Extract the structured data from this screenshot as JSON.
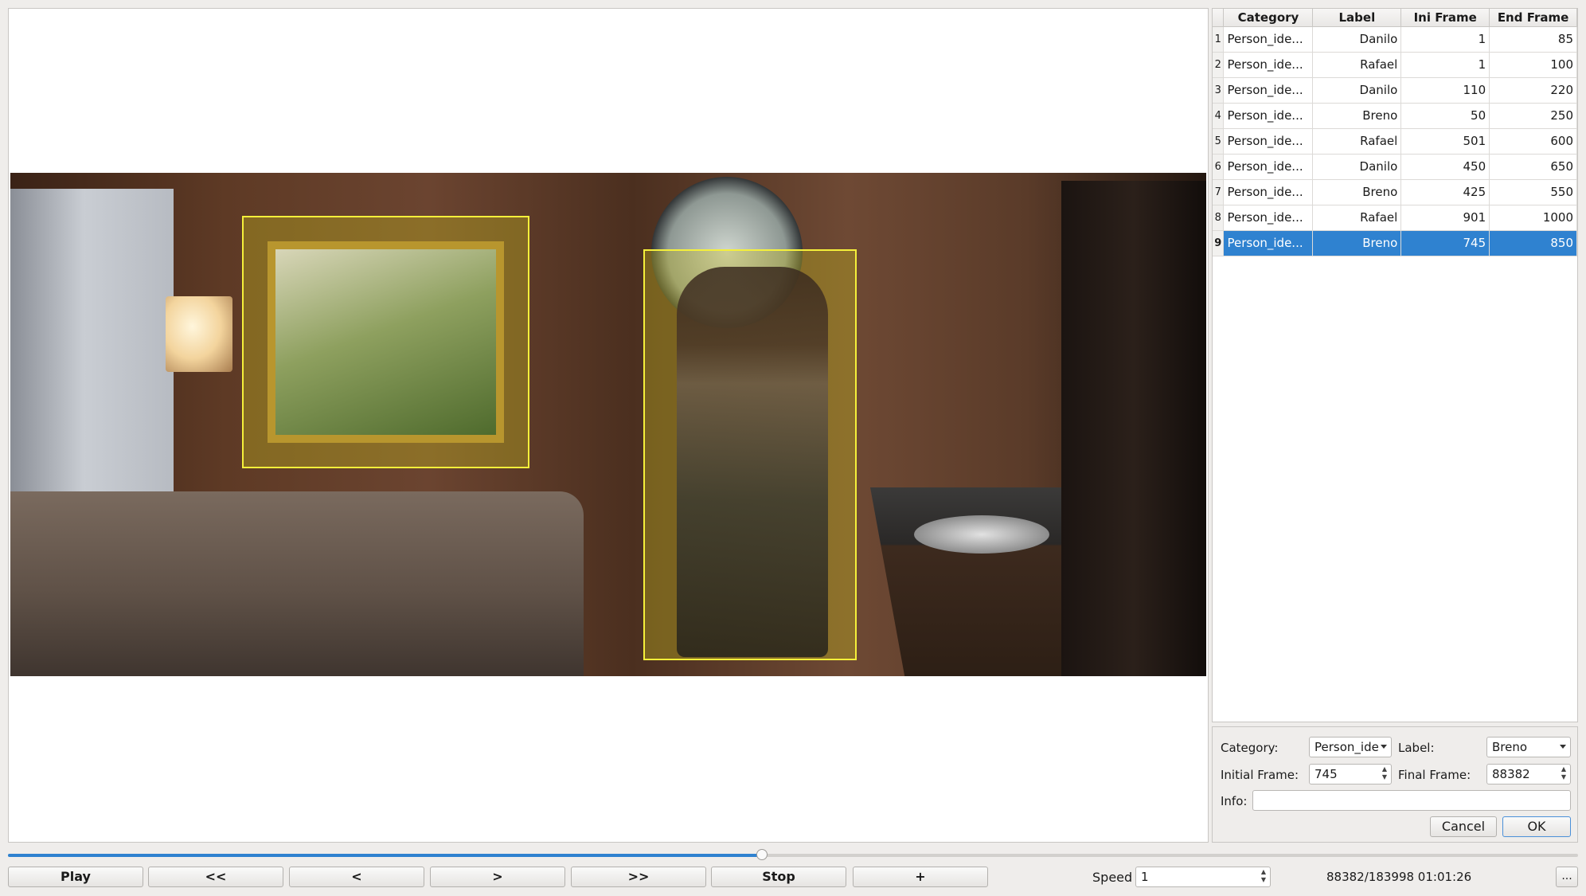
{
  "table": {
    "headers": [
      "Category",
      "Label",
      "Ini Frame",
      "End Frame"
    ],
    "rows": [
      {
        "index": "1",
        "category": "Person_ide...",
        "label": "Danilo",
        "ini": "1",
        "end": "85"
      },
      {
        "index": "2",
        "category": "Person_ide...",
        "label": "Rafael",
        "ini": "1",
        "end": "100"
      },
      {
        "index": "3",
        "category": "Person_ide...",
        "label": "Danilo",
        "ini": "110",
        "end": "220"
      },
      {
        "index": "4",
        "category": "Person_ide...",
        "label": "Breno",
        "ini": "50",
        "end": "250"
      },
      {
        "index": "5",
        "category": "Person_ide...",
        "label": "Rafael",
        "ini": "501",
        "end": "600"
      },
      {
        "index": "6",
        "category": "Person_ide...",
        "label": "Danilo",
        "ini": "450",
        "end": "650"
      },
      {
        "index": "7",
        "category": "Person_ide...",
        "label": "Breno",
        "ini": "425",
        "end": "550"
      },
      {
        "index": "8",
        "category": "Person_ide...",
        "label": "Rafael",
        "ini": "901",
        "end": "1000"
      },
      {
        "index": "9",
        "category": "Person_ide...",
        "label": "Breno",
        "ini": "745",
        "end": "850"
      }
    ],
    "selected_row": 9
  },
  "form": {
    "category_label": "Category:",
    "category_value": "Person_ide",
    "label_label": "Label:",
    "label_value": "Breno",
    "initial_frame_label": "Initial Frame:",
    "initial_frame_value": "745",
    "final_frame_label": "Final Frame:",
    "final_frame_value": "88382",
    "info_label": "Info:",
    "info_value": "",
    "cancel_label": "Cancel",
    "ok_label": "OK"
  },
  "controls": {
    "play_label": "Play",
    "rewind_label": "<<",
    "prev_label": "<",
    "next_label": ">",
    "forward_label": ">>",
    "stop_label": "Stop",
    "add_label": "+",
    "speed_label": "Speed",
    "speed_value": "1",
    "frame_info": "88382/183998 01:01:26",
    "more_label": "...",
    "progress_fraction": 0.4803
  },
  "colors": {
    "selection": "#2f82d0",
    "bbox": "#f5f03a"
  }
}
